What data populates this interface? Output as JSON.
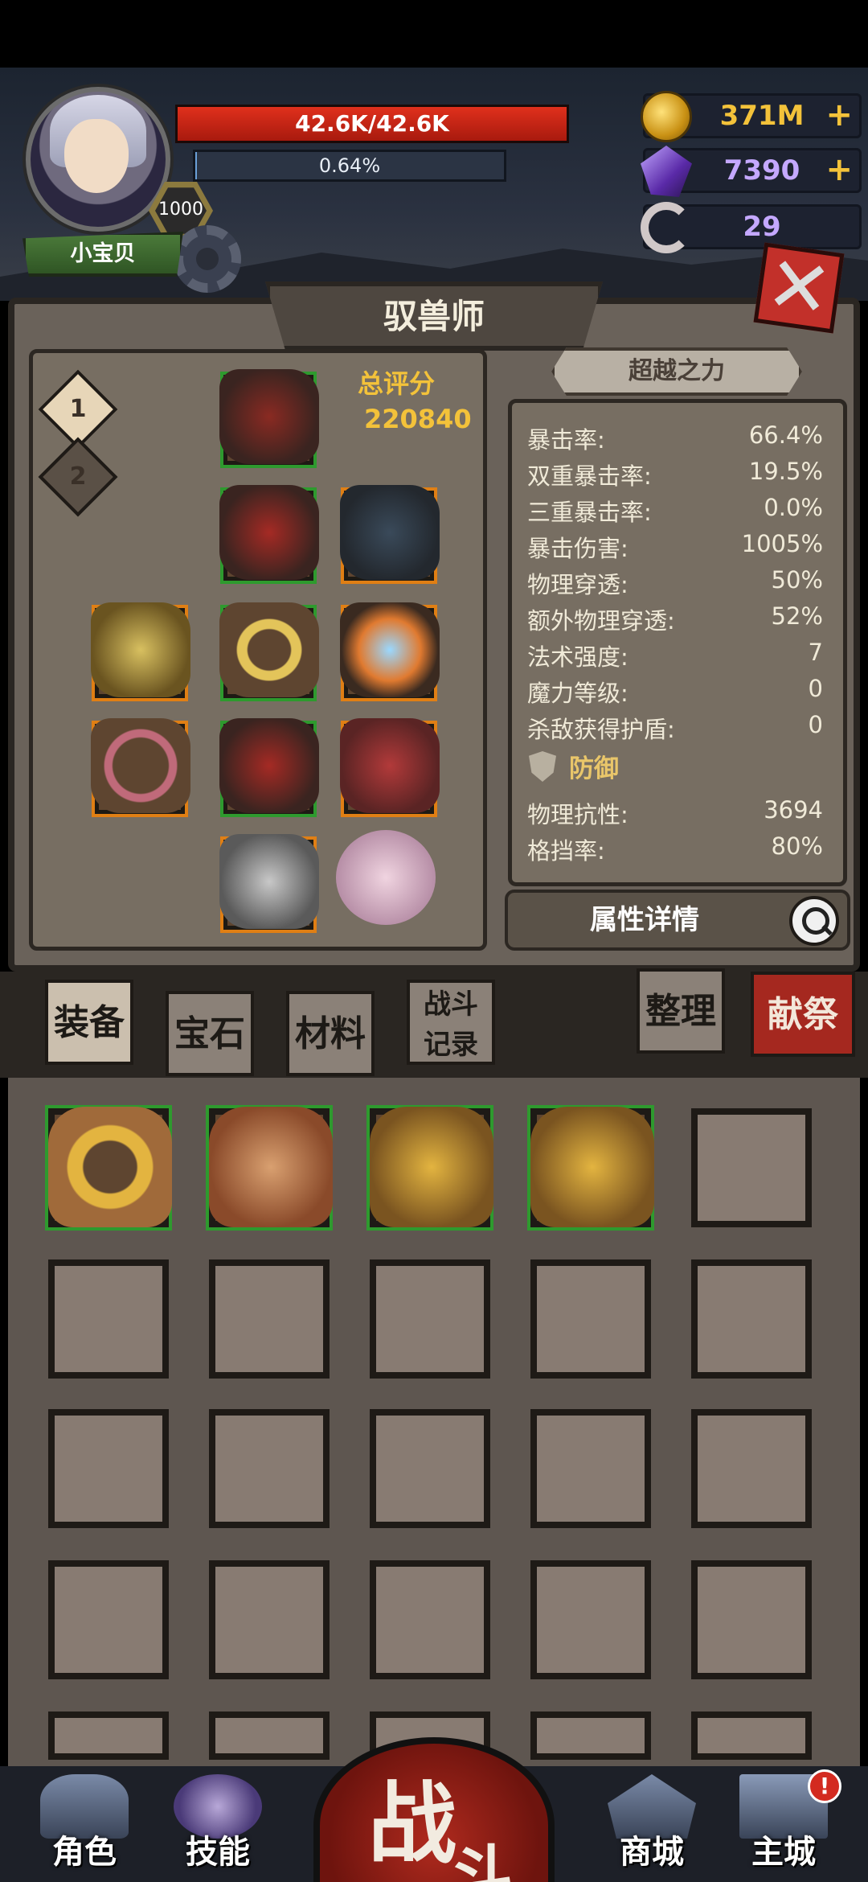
{
  "header": {
    "player_name": "小宝贝",
    "level_badge": "1000",
    "hp_text": "42.6K/42.6K",
    "hp_fraction": 1.0,
    "exp_text": "0.64%",
    "exp_fraction": 0.0064
  },
  "resources": [
    {
      "name": "gold",
      "value": "371M",
      "icon": "coin-icon",
      "color": "#f3c23a",
      "plus": "+"
    },
    {
      "name": "crystal",
      "value": "7390",
      "icon": "crystal-icon",
      "color": "#c4a8ff",
      "plus": "+"
    },
    {
      "name": "horn",
      "value": "29",
      "icon": "horn-icon",
      "color": "#c4a8ff",
      "plus": ""
    }
  ],
  "panel": {
    "title": "驭兽师",
    "close_label": "✕",
    "loadout_tabs": [
      "1",
      "2"
    ],
    "score_label": "总评分",
    "score_value": "220840",
    "super_button": "超越之力",
    "stats": [
      {
        "k": "暴击率:",
        "v": "66.4%"
      },
      {
        "k": "双重暴击率:",
        "v": "19.5%"
      },
      {
        "k": "三重暴击率:",
        "v": "0.0%"
      },
      {
        "k": "暴击伤害:",
        "v": "1005%"
      },
      {
        "k": "物理穿透:",
        "v": "50%"
      },
      {
        "k": "额外物理穿透:",
        "v": "52%"
      },
      {
        "k": "法术强度:",
        "v": "7"
      },
      {
        "k": "魔力等级:",
        "v": "0"
      },
      {
        "k": "杀敌获得护盾:",
        "v": "0"
      }
    ],
    "defense_header": "防御",
    "defense_stats": [
      {
        "k": "物理抗性:",
        "v": "3694"
      },
      {
        "k": "格挡率:",
        "v": "80%"
      }
    ],
    "detail_button": "属性详情"
  },
  "tabs": {
    "equipment": "装备",
    "gems": "宝石",
    "materials": "材料",
    "battle_log_1": "战斗",
    "battle_log_2": "记录",
    "sort": "整理",
    "sacrifice": "献祭"
  },
  "bottom_nav": {
    "character": "角色",
    "skills": "技能",
    "fight_1": "战",
    "fight_2": "斗",
    "shop": "商城",
    "main_city": "主城",
    "alert": "!"
  },
  "colors": {
    "accent_gold": "#f3c23a",
    "hp_red": "#e0301c",
    "rarity_green": "#2e9a2e",
    "rarity_orange": "#e07f14"
  }
}
